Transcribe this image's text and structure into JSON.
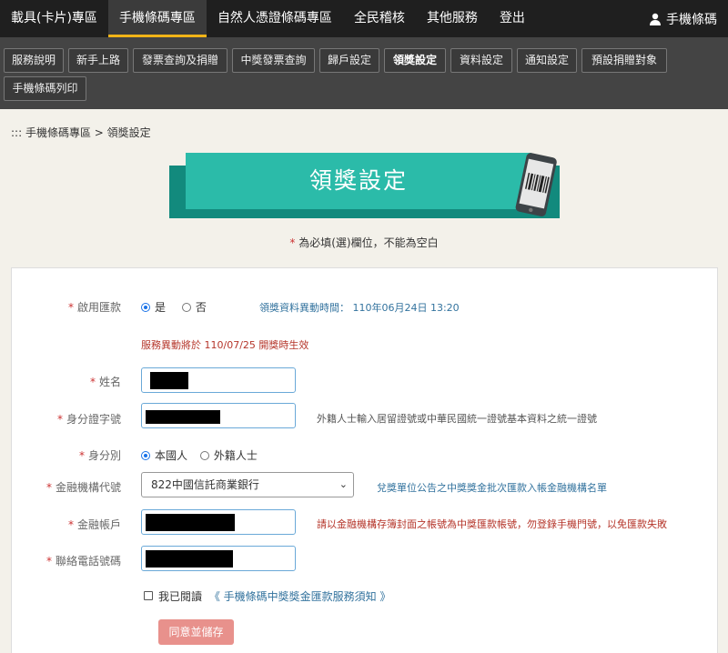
{
  "topnav": {
    "items": [
      "載具(卡片)專區",
      "手機條碼專區",
      "自然人憑證條碼專區",
      "全民稽核",
      "其他服務",
      "登出"
    ],
    "user": "手機條碼"
  },
  "subnav": {
    "items": [
      "服務說明",
      "新手上路",
      "發票查詢及捐贈",
      "中獎發票查詢",
      "歸戶設定",
      "領獎設定",
      "資料設定",
      "通知設定",
      "預設捐贈對象",
      "手機條碼列印"
    ],
    "active": "領獎設定"
  },
  "breadcrumb": {
    "prefix": ":::",
    "path": "手機條碼專區 > 領獎設定"
  },
  "banner": {
    "title": "領獎設定"
  },
  "required_note": {
    "star": "*",
    "text": "為必填(選)欄位，不能為空白"
  },
  "form": {
    "remit": {
      "label": "啟用匯款",
      "yes": "是",
      "no": "否",
      "selected": "yes",
      "change_time": "領獎資料異動時間： 110年06月24日 13:20",
      "effective": "服務異動將於 110/07/25 開獎時生效"
    },
    "name": {
      "label": "姓名"
    },
    "id_number": {
      "label": "身分證字號",
      "hint": "外籍人士輸入居留證號或中華民國統一證號基本資料之統一證號"
    },
    "identity": {
      "label": "身分別",
      "options": [
        "本國人",
        "外籍人士"
      ],
      "selected": "本國人"
    },
    "bank_code": {
      "label": "金融機構代號",
      "value": "822中國信託商業銀行",
      "hint": "兌獎單位公告之中獎獎金批次匯款入帳金融機構名單"
    },
    "account": {
      "label": "金融帳戶",
      "hint": "請以金融機構存簿封面之帳號為中獎匯款帳號，勿登錄手機門號，以免匯款失敗"
    },
    "phone": {
      "label": "聯絡電話號碼"
    },
    "agree": {
      "text": "我已閱讀",
      "link": "《 手機條碼中獎獎金匯款服務須知 》"
    },
    "submit": "同意並儲存"
  },
  "colors": {
    "accent": "#f2b417",
    "banner": "#2bbba9",
    "banner_dark": "#128a7d",
    "required": "#c33333",
    "button": "#e8918c"
  }
}
